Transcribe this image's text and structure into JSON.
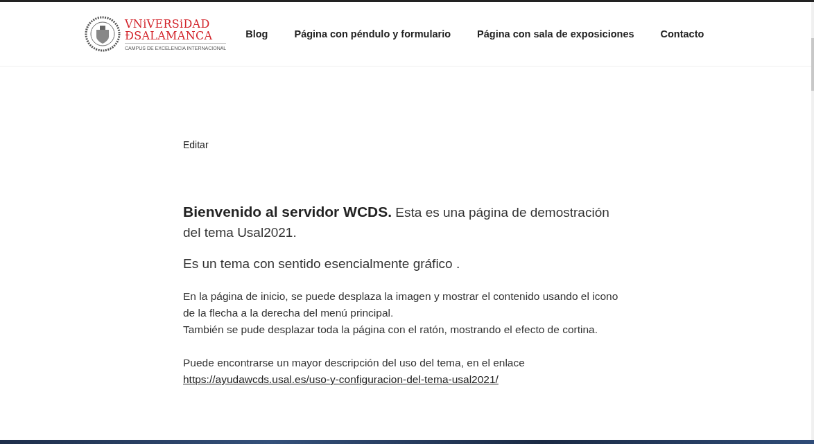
{
  "logo": {
    "line_1": "VNiVERSiDAD",
    "line_2": "ÐSALAMANCA",
    "tagline": "CAMPUS DE EXCELENCIA INTERNACIONAL"
  },
  "nav": [
    {
      "label": "Blog"
    },
    {
      "label": "Página con péndulo y formulario"
    },
    {
      "label": "Página con sala de exposiciones"
    },
    {
      "label": "Contacto"
    }
  ],
  "edit_link": "Editar",
  "intro": "**Bienvenido al servidor WCDS.** Esta es una página de demostración del tema Usal2021.",
  "subtitle": "Es un tema con sentido esencialmente gráfico .",
  "paragraph_1": [
    "En la página de inicio, se puede desplaza la imagen y mostrar el contenido usando el icono de la flecha a la derecha del menú principal.",
    "También se pude desplazar toda la página con el ratón, mostrando el efecto de cortina."
  ],
  "paragraph_2": {
    "text": "Puede encontrarse un mayor descripción del uso del tema, en el enlace",
    "link": "https://ayudawcds.usal.es/uso-y-configuracion-del-tema-usal2021/"
  }
}
